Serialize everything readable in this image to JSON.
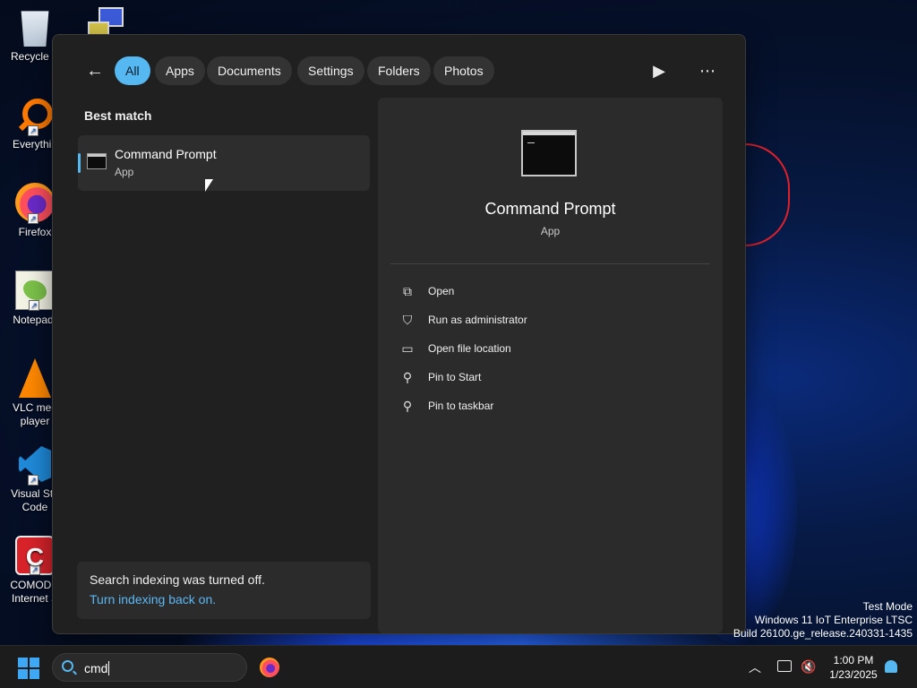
{
  "desktop": {
    "icons": [
      {
        "label": "Recycle B",
        "icon": "recycle-bin-icon"
      },
      {
        "label": "Everythin",
        "icon": "everything-search-icon"
      },
      {
        "label": "Firefox",
        "icon": "firefox-icon"
      },
      {
        "label": "Notepad-",
        "icon": "notepad-plus-plus-icon"
      },
      {
        "label": "VLC med\nplayer",
        "icon": "vlc-icon"
      },
      {
        "label": "Visual Stu\nCode",
        "icon": "vscode-icon"
      },
      {
        "label": "COMODO\nInternet S",
        "icon": "comodo-icon"
      }
    ]
  },
  "search": {
    "filters": [
      "All",
      "Apps",
      "Documents",
      "Settings",
      "Folders",
      "Photos"
    ],
    "active_filter": "All",
    "best_match_label": "Best match",
    "result": {
      "title": "Command Prompt",
      "subtitle": "App"
    },
    "notice": {
      "message": "Search indexing was turned off.",
      "link": "Turn indexing back on."
    },
    "preview": {
      "name": "Command Prompt",
      "type": "App",
      "actions": [
        {
          "label": "Open",
          "icon": "open-external-icon"
        },
        {
          "label": "Run as administrator",
          "icon": "shield-admin-icon"
        },
        {
          "label": "Open file location",
          "icon": "folder-icon"
        },
        {
          "label": "Pin to Start",
          "icon": "pin-icon"
        },
        {
          "label": "Pin to taskbar",
          "icon": "pin-icon"
        }
      ]
    }
  },
  "watermark": {
    "line1": "Test Mode",
    "line2": "Windows 11 IoT Enterprise LTSC",
    "line3": "Build 26100.ge_release.240331-1435"
  },
  "taskbar": {
    "search_value": "cmd",
    "time": "1:00 PM",
    "date": "1/23/2025"
  }
}
